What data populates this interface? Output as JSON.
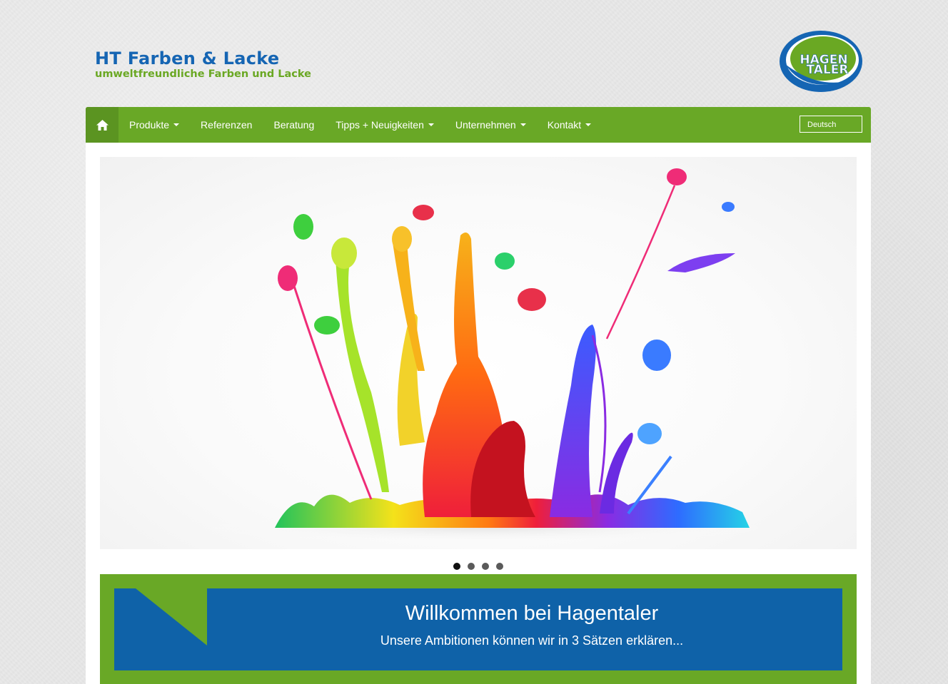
{
  "header": {
    "brand_title": "HT Farben & Lacke",
    "brand_subtitle": "umweltfreundliche Farben und Lacke",
    "logo_text_line1": "HAGEN",
    "logo_text_line2": "TALER"
  },
  "nav": {
    "home_icon": "home-icon",
    "items": [
      {
        "label": "Produkte",
        "dropdown": true
      },
      {
        "label": "Referenzen",
        "dropdown": false
      },
      {
        "label": "Beratung",
        "dropdown": false
      },
      {
        "label": "Tipps + Neuigkeiten",
        "dropdown": true
      },
      {
        "label": "Unternehmen",
        "dropdown": true
      },
      {
        "label": "Kontakt",
        "dropdown": true
      }
    ],
    "language": "Deutsch"
  },
  "slider": {
    "slides_count": 4,
    "active_slide": 1
  },
  "welcome": {
    "title": "Willkommen bei Hagentaler",
    "subtitle": "Unsere Ambitionen können wir in 3 Sätzen erklären..."
  },
  "colors": {
    "brand_green": "#69a826",
    "brand_blue": "#0f62a8",
    "title_blue": "#1565b3"
  }
}
